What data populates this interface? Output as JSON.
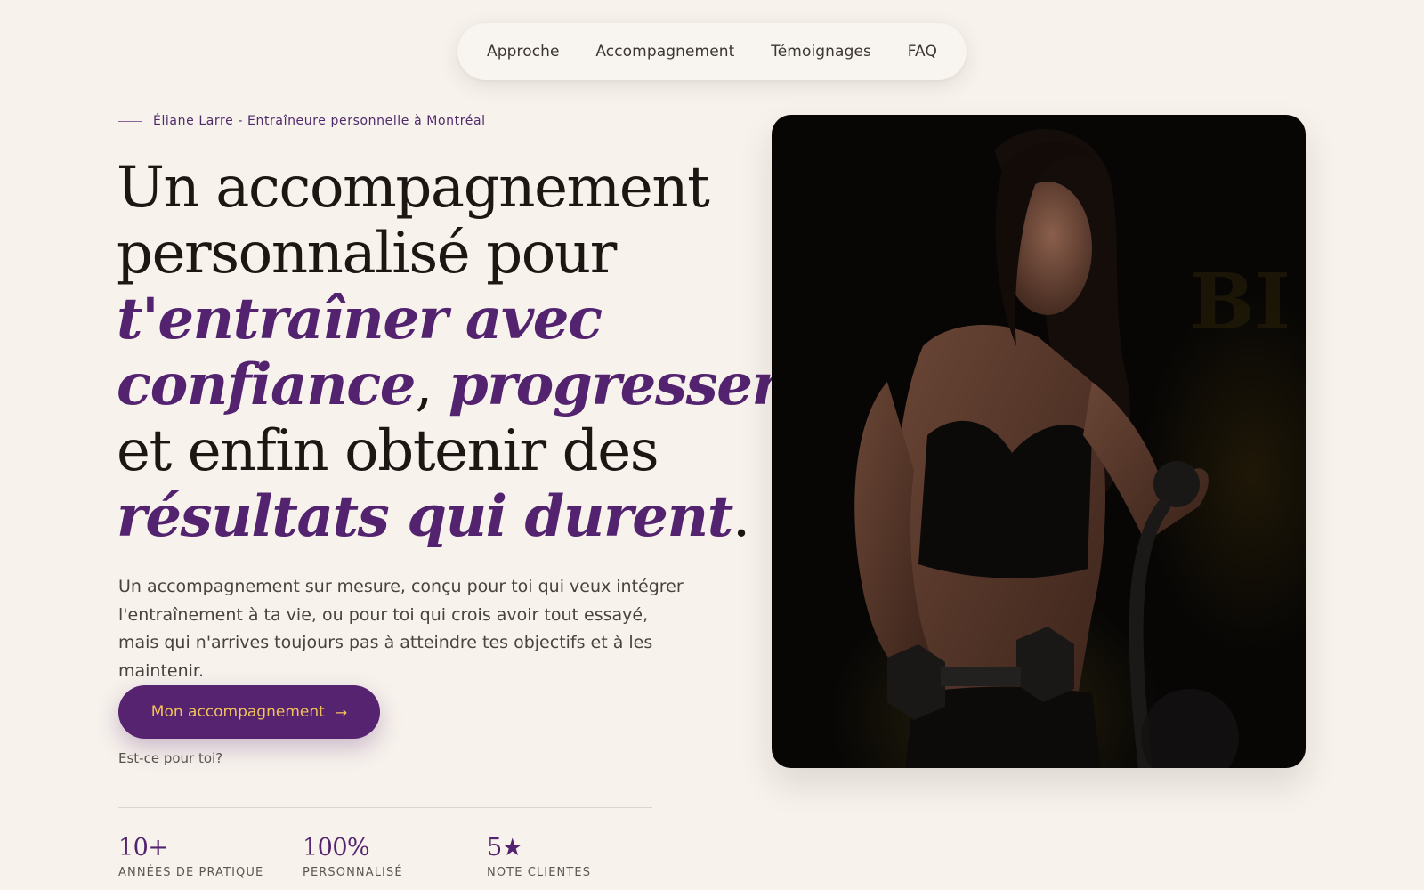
{
  "nav": {
    "items": [
      {
        "label": "Approche"
      },
      {
        "label": "Accompagnement"
      },
      {
        "label": "Témoignages"
      },
      {
        "label": "FAQ"
      }
    ]
  },
  "hero": {
    "eyebrow": "Éliane Larre - Entraîneure personnelle à Montréal",
    "headline": {
      "line1": "Un accompagnement",
      "line2": "personnalisé pour",
      "line3_em": "t'entraîner avec",
      "line4_em_a": "confiance",
      "line4_sep": ", ",
      "line4_em_b": "progresser",
      "line5": "et enfin obtenir des",
      "line6_em": "résultats qui durent",
      "line6_end": "."
    },
    "lead": "Un accompagnement sur mesure, conçu pour toi qui veux intégrer l'entraînement à ta vie, ou pour toi qui crois avoir tout essayé, mais qui n'arrives toujours pas à atteindre tes objectifs et à les maintenir.",
    "cta_label": "Mon accompagnement",
    "cta_icon": "arrow-right-icon",
    "secondary_link": "Est-ce pour toi?"
  },
  "stats": [
    {
      "value": "10+",
      "label": "Années de pratique"
    },
    {
      "value": "100%",
      "label": "Personnalisé"
    },
    {
      "value": "5★",
      "label": "Note clientes"
    }
  ],
  "colors": {
    "background": "#f7f2ec",
    "accent_purple": "#53236f",
    "cta_text": "#f2c25a",
    "text_dark": "#1c1713"
  }
}
